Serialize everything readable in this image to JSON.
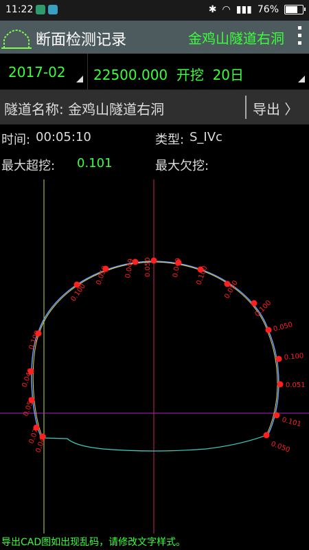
{
  "status": {
    "time": "11:22",
    "battery": "76%",
    "battery_level": 0.76
  },
  "appbar": {
    "title": "断面检测记录",
    "tunnel": "金鸡山隧道右洞"
  },
  "selectors": {
    "month": "2017-02",
    "record": "22500.000  开挖  20日"
  },
  "namebar": {
    "tunnel_name": "隧道名称: 金鸡山隧道右洞",
    "export": "导出 〉"
  },
  "info": {
    "time_label": "时间:",
    "time_value": "00:05:10",
    "type_label": "类型:",
    "type_value": "S_IVc",
    "overbreak_label": "最大超挖:",
    "overbreak_value": "0.101",
    "underbreak_label": "最大欠挖:",
    "underbreak_value": ""
  },
  "plot_labels": [
    "0.049",
    "0.074",
    "0.050",
    "0.049",
    "0.100",
    "0.100",
    "0.050",
    "0.049",
    "0.050",
    "0.049",
    "0.100",
    "0.050",
    "0.100",
    "0.050",
    "0.100",
    "0.051",
    "0.101",
    "0.050"
  ],
  "colors": {
    "accent_green": "#39ff3a",
    "point_red": "#ff2020",
    "appbar": "#4e5b5e"
  },
  "footer": {
    "note": "导出CAD图如出现乱码，请修改文字样式。"
  }
}
